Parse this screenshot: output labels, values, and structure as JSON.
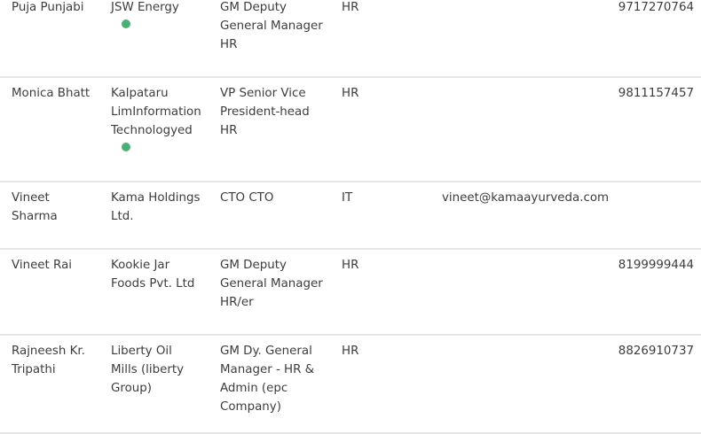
{
  "colors": {
    "online_dot": "#4caf78",
    "row_divider": "#e5e5e5",
    "text": "#3d3d3d"
  },
  "rows": [
    {
      "name": [
        "Puja Punjabi"
      ],
      "company": [
        "JSW Energy"
      ],
      "online": true,
      "title": [
        "GM Deputy",
        "General Manager",
        "HR"
      ],
      "department": "HR",
      "email": "",
      "phone": "9717270764"
    },
    {
      "name": [
        "Monica Bhatt"
      ],
      "company": [
        "Kalpataru",
        "LimInformation",
        "Technologyed"
      ],
      "online": true,
      "title": [
        "VP Senior Vice",
        "President-head",
        "HR"
      ],
      "department": "HR",
      "email": "",
      "phone": "9811157457"
    },
    {
      "name": [
        "Vineet",
        "Sharma"
      ],
      "company": [
        "Kama Holdings",
        "Ltd."
      ],
      "online": false,
      "title": [
        "CTO CTO"
      ],
      "department": "IT",
      "email": "vineet@kamaayurveda.com",
      "phone": ""
    },
    {
      "name": [
        "Vineet Rai"
      ],
      "company": [
        "Kookie Jar",
        "Foods Pvt. Ltd"
      ],
      "online": false,
      "title": [
        "GM Deputy",
        "General Manager",
        "HR/er"
      ],
      "department": "HR",
      "email": "",
      "phone": "8199999444"
    },
    {
      "name": [
        "Rajneesh Kr.",
        "Tripathi"
      ],
      "company": [
        "Liberty Oil",
        "Mills (liberty",
        "Group)"
      ],
      "online": false,
      "title": [
        "GM Dy. General",
        "Manager - HR &",
        "Admin (epc",
        "Company)"
      ],
      "department": "HR",
      "email": "",
      "phone": "8826910737"
    }
  ]
}
